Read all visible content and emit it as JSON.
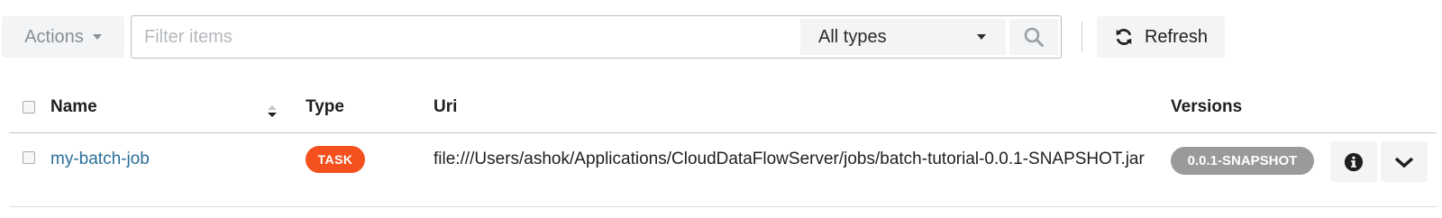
{
  "toolbar": {
    "actions_label": "Actions",
    "filter_placeholder": "Filter items",
    "filter_value": "",
    "type_select_value": "All types",
    "refresh_label": "Refresh"
  },
  "table": {
    "columns": [
      "Name",
      "Type",
      "Uri",
      "Versions"
    ],
    "rows": [
      {
        "name": "my-batch-job",
        "type": "TASK",
        "uri": "file:///Users/ashok/Applications/CloudDataFlowServer/jobs/batch-tutorial-0.0.1-SNAPSHOT.jar",
        "version": "0.0.1-SNAPSHOT"
      }
    ]
  },
  "icons": {
    "actions_caret": "caret-down-icon",
    "type_caret": "caret-down-icon",
    "search": "search-icon",
    "refresh": "refresh-icon",
    "sort": "sort-icon",
    "info": "info-icon",
    "expand": "chevron-down-icon"
  },
  "colors": {
    "link": "#2a6f99",
    "task_badge": "#f4511e",
    "version_badge": "#9a9a9a",
    "button_bg": "#f3f4f5"
  }
}
